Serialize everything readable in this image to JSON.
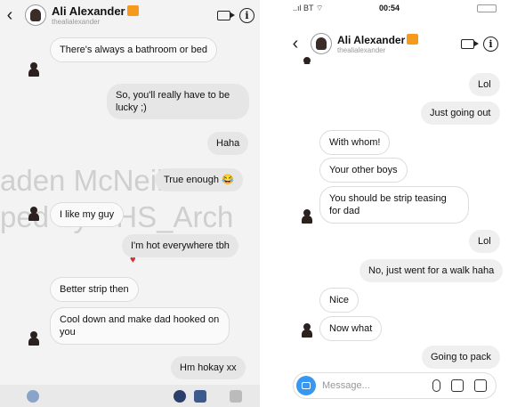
{
  "left": {
    "name": "Ali Alexander",
    "handle": "thealialexander",
    "messages": [
      {
        "text": "There's always a bathroom or bed"
      },
      {
        "text": "So, you'll really have to be lucky ;)"
      },
      {
        "text": "Haha"
      },
      {
        "text": "True enough 😂"
      },
      {
        "text": "I like my guy"
      },
      {
        "text": "I'm hot everywhere tbh"
      },
      {
        "text": "Better strip then"
      },
      {
        "text": "Cool down and make dad hooked on you"
      },
      {
        "text": "Hm hokay xx"
      }
    ],
    "watermark_1": "aden McNeil Liv",
    "watermark_2": "ped by VHS_Arch"
  },
  "right": {
    "status": {
      "carrier": "..ıl BT ⌔",
      "time": "00:54"
    },
    "name": "Ali Alexander",
    "handle": "thealialexander",
    "messages": [
      {
        "text": "Lol"
      },
      {
        "text": "Just going out"
      },
      {
        "text": "With whom!"
      },
      {
        "text": "Your other boys"
      },
      {
        "text": "You should be strip teasing for dad"
      },
      {
        "text": "Lol"
      },
      {
        "text": "No, just went for a walk haha"
      },
      {
        "text": "Nice"
      },
      {
        "text": "Now what"
      },
      {
        "text": "Going to pack"
      }
    ],
    "composer_placeholder": "Message..."
  },
  "icons": {
    "back": "‹",
    "info": "i"
  }
}
